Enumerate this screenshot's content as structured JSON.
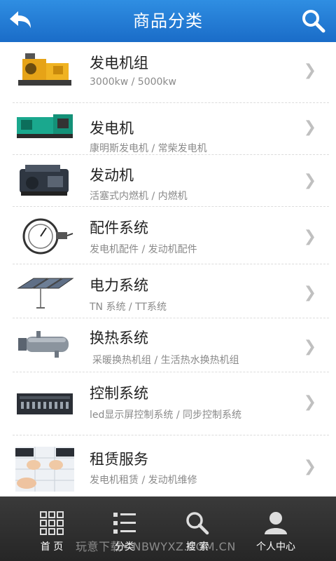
{
  "header": {
    "title": "商品分类",
    "back_icon": "back-arrow-icon",
    "search_icon": "search-icon",
    "bg_color": "#1f78d1"
  },
  "categories": [
    {
      "name": "发电机组",
      "sub": "3000kw / 5000kw",
      "thumb": "generator-set-image"
    },
    {
      "name": "发电机",
      "sub": "康明斯发电机 / 常柴发电机",
      "thumb": "generator-image"
    },
    {
      "name": "发动机",
      "sub": "活塞式内燃机 / 内燃机",
      "thumb": "engine-image"
    },
    {
      "name": "配件系统",
      "sub": "发电机配件 / 发动机配件",
      "thumb": "gauge-image"
    },
    {
      "name": "电力系统",
      "sub": "TN 系统 / TT系统",
      "thumb": "solar-panel-image"
    },
    {
      "name": "换热系统",
      "sub": "采暖换热机组 / 生活热水换热机组",
      "thumb": "heat-exchanger-image"
    },
    {
      "name": "控制系统",
      "sub": "led显示屏控制系统 / 同步控制系统",
      "thumb": "control-panel-image"
    },
    {
      "name": "租赁服务",
      "sub": "发电机租赁 / 发动机维修",
      "thumb": "rental-handshake-image"
    }
  ],
  "tabs": [
    {
      "label": "首 页",
      "icon": "grid-home-icon"
    },
    {
      "label": "分类",
      "icon": "list-category-icon"
    },
    {
      "label": "搜 索",
      "icon": "search-icon"
    },
    {
      "label": "个人中心",
      "icon": "user-icon"
    }
  ],
  "watermark": "玩意下载• NBWYXZ.COM.CN"
}
